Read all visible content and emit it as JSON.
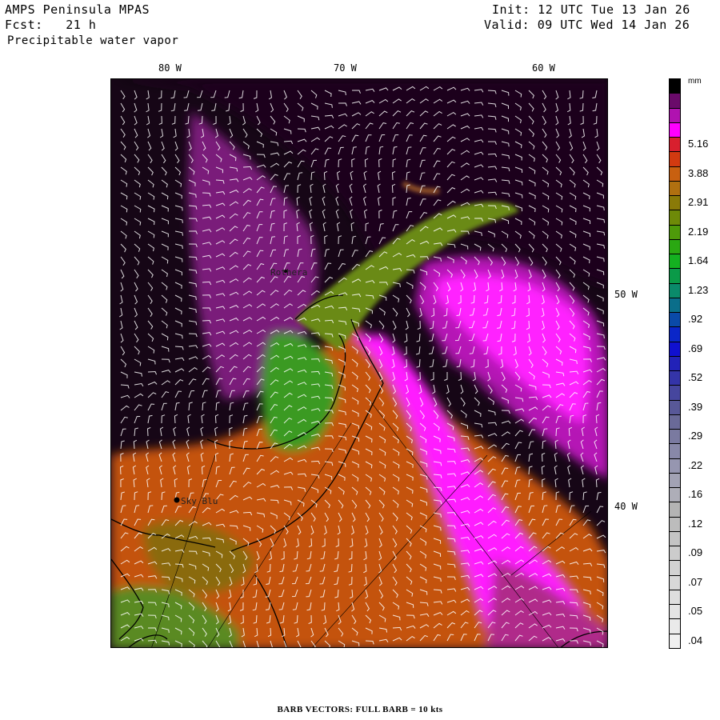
{
  "header": {
    "model_line": "AMPS Peninsula MPAS",
    "fcst_line": "Fcst:   21 h",
    "field_line": "Precipitable water vapor",
    "init_line": "Init: 12 UTC Tue 13 Jan 26",
    "valid_line": "Valid: 09 UTC Wed 14 Jan 26"
  },
  "lon_labels": [
    "80 W",
    "70 W",
    "60 W"
  ],
  "lat_labels": [
    "50 W",
    "40 W"
  ],
  "stations": [
    {
      "name": "Rothera"
    },
    {
      "name": "Sky Blu"
    }
  ],
  "colorbar": {
    "unit": "mm",
    "levels": [
      {
        "label": "",
        "color": "#000000"
      },
      {
        "label": "",
        "color": "#6a0a6a"
      },
      {
        "label": "",
        "color": "#b012b0"
      },
      {
        "label": "",
        "color": "#ff00ff"
      },
      {
        "label": "5.16",
        "color": "#d81f2e"
      },
      {
        "label": "",
        "color": "#d23a10"
      },
      {
        "label": "3.88",
        "color": "#c86010"
      },
      {
        "label": "",
        "color": "#b07010"
      },
      {
        "label": "2.91",
        "color": "#8a7a08"
      },
      {
        "label": "",
        "color": "#6e8a08"
      },
      {
        "label": "2.19",
        "color": "#4e9a0a"
      },
      {
        "label": "",
        "color": "#2aa812"
      },
      {
        "label": "1.64",
        "color": "#14b020"
      },
      {
        "label": "",
        "color": "#0a9a48"
      },
      {
        "label": "1.23",
        "color": "#0a8a6a"
      },
      {
        "label": "",
        "color": "#0a6e8a"
      },
      {
        "label": ".92",
        "color": "#0a4aa8"
      },
      {
        "label": "",
        "color": "#0a26c8"
      },
      {
        "label": ".69",
        "color": "#1010d0"
      },
      {
        "label": "",
        "color": "#2222b8"
      },
      {
        "label": ".52",
        "color": "#3434a8"
      },
      {
        "label": "",
        "color": "#46469e"
      },
      {
        "label": ".39",
        "color": "#585898"
      },
      {
        "label": "",
        "color": "#6a6a98"
      },
      {
        "label": ".29",
        "color": "#7a7aa0"
      },
      {
        "label": "",
        "color": "#8888a8"
      },
      {
        "label": ".22",
        "color": "#9696b0"
      },
      {
        "label": "",
        "color": "#a2a2b4"
      },
      {
        "label": ".16",
        "color": "#aeaeb8"
      },
      {
        "label": "",
        "color": "#b4b4b4"
      },
      {
        "label": ".12",
        "color": "#bcbcbc"
      },
      {
        "label": "",
        "color": "#c4c4c4"
      },
      {
        "label": ".09",
        "color": "#cccccc"
      },
      {
        "label": "",
        "color": "#d2d2d2"
      },
      {
        "label": ".07",
        "color": "#d8d8d8"
      },
      {
        "label": "",
        "color": "#dedede"
      },
      {
        "label": ".05",
        "color": "#e4e4e4"
      },
      {
        "label": "",
        "color": "#eaeaea"
      },
      {
        "label": ".04",
        "color": "#f0f0f0"
      }
    ]
  },
  "footer": "BARB VECTORS:  FULL BARB = 10 kts"
}
